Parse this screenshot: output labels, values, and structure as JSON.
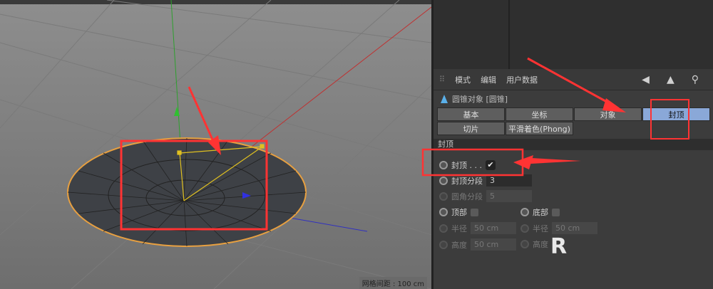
{
  "viewport": {
    "grid_spacing_label": "网格间距 : 100 cm"
  },
  "menu": {
    "items": [
      "模式",
      "编辑",
      "用户数据"
    ]
  },
  "object": {
    "title": "圆锥对象 [圆锥]"
  },
  "tabs": [
    {
      "label": "基本"
    },
    {
      "label": "坐标"
    },
    {
      "label": "对象"
    },
    {
      "label": "封顶",
      "active": true
    },
    {
      "label": "切片"
    },
    {
      "label": "平滑着色(Phong)"
    }
  ],
  "section": {
    "title": "封顶"
  },
  "fields": {
    "caps": {
      "label": "封顶 . . .",
      "checked": true,
      "check_glyph": "✔"
    },
    "cap_segments": {
      "label": "封顶分段",
      "value": "3"
    },
    "fillet_segments": {
      "label": "圆角分段",
      "value": "5"
    },
    "top": {
      "label": "顶部"
    },
    "bottom": {
      "label": "底部"
    },
    "top_radius": {
      "label": "半径",
      "value": "50 cm"
    },
    "top_height": {
      "label": "高度",
      "value": "50 cm"
    },
    "bottom_radius": {
      "label": "半径",
      "value": "50 cm"
    },
    "bottom_height": {
      "label": "高度",
      "value": ""
    }
  },
  "colors": {
    "accent_tab": "#8aa8d8",
    "annotation": "#ff3333",
    "cone_edge": "#e8a040"
  }
}
